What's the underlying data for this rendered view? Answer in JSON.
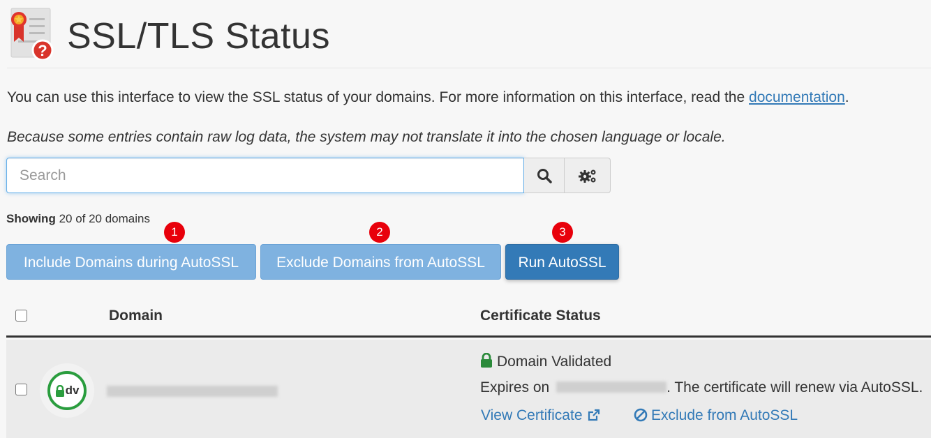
{
  "page": {
    "title": "SSL/TLS Status",
    "intro_text": "You can use this interface to view the SSL status of your domains. For more information on this interface, read the ",
    "intro_link": "documentation",
    "intro_end": ".",
    "note": "Because some entries contain raw log data, the system may not translate it into the chosen language or locale."
  },
  "search": {
    "placeholder": "Search",
    "search_icon": "search-icon",
    "settings_icon": "gears-icon"
  },
  "showing": {
    "label": "Showing",
    "value": "20 of 20 domains"
  },
  "markers": [
    "1",
    "2",
    "3"
  ],
  "actions": {
    "include": "Include Domains during AutoSSL",
    "exclude": "Exclude Domains from AutoSSL",
    "run": "Run AutoSSL"
  },
  "table": {
    "columns": [
      "Domain",
      "Certificate Status"
    ],
    "rows": [
      {
        "badge": "dv",
        "status": "Domain Validated",
        "expires_prefix": "Expires on",
        "expires_suffix": ". The certificate will renew via AutoSSL.",
        "view_certificate": "View Certificate",
        "exclude_link": "Exclude from AutoSSL"
      }
    ]
  },
  "colors": {
    "primary": "#337ab7",
    "primary_light": "#7fb2e0",
    "marker": "#e8000b",
    "validated_green": "#2a9d3e"
  }
}
